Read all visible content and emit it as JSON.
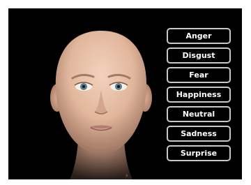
{
  "emotion_buttons": [
    {
      "label": "Anger"
    },
    {
      "label": "Disgust"
    },
    {
      "label": "Fear"
    },
    {
      "label": "Happiness"
    },
    {
      "label": "Neutral"
    },
    {
      "label": "Sadness"
    },
    {
      "label": "Surprise"
    }
  ],
  "footer": {
    "mark": "a"
  },
  "colors": {
    "background": "#000000",
    "button_border": "#c8c8c8",
    "button_text": "#ffffff",
    "skin": "#e8c2aa"
  },
  "icons": {
    "face": "avatar-face-neutral"
  }
}
